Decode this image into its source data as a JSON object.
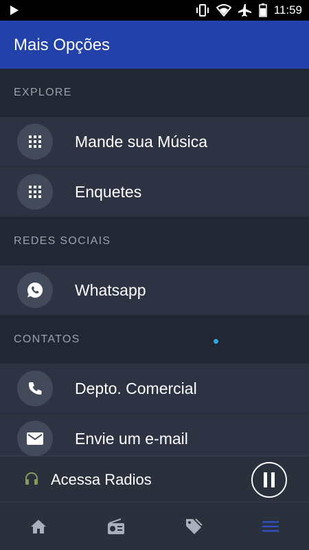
{
  "status_bar": {
    "time": "11:59",
    "icons": [
      "play-icon",
      "vibrate-icon",
      "wifi-icon",
      "airplane-icon",
      "battery-icon"
    ]
  },
  "app_bar": {
    "title": "Mais Opções",
    "color": "#2342a9"
  },
  "sections": [
    {
      "header": "EXPLORE",
      "items": [
        {
          "label": "Mande sua Música",
          "icon": "apps-grid-icon"
        },
        {
          "label": "Enquetes",
          "icon": "apps-grid-icon"
        }
      ]
    },
    {
      "header": "REDES SOCIAIS",
      "items": [
        {
          "label": "Whatsapp",
          "icon": "whatsapp-icon"
        }
      ]
    },
    {
      "header": "CONTATOS",
      "items": [
        {
          "label": "Depto. Comercial",
          "icon": "phone-icon"
        },
        {
          "label": "Envie um e-mail",
          "icon": "mail-icon"
        }
      ]
    }
  ],
  "player": {
    "title": "Acessa Radios",
    "state": "playing"
  },
  "bottom_nav": {
    "items": [
      {
        "name": "home",
        "icon": "home-icon"
      },
      {
        "name": "radio",
        "icon": "radio-icon"
      },
      {
        "name": "tags",
        "icon": "tag-icon"
      },
      {
        "name": "menu",
        "icon": "menu-icon",
        "active": true
      }
    ],
    "active_color": "#2f4fbf",
    "inactive_color": "#aab0bb"
  }
}
